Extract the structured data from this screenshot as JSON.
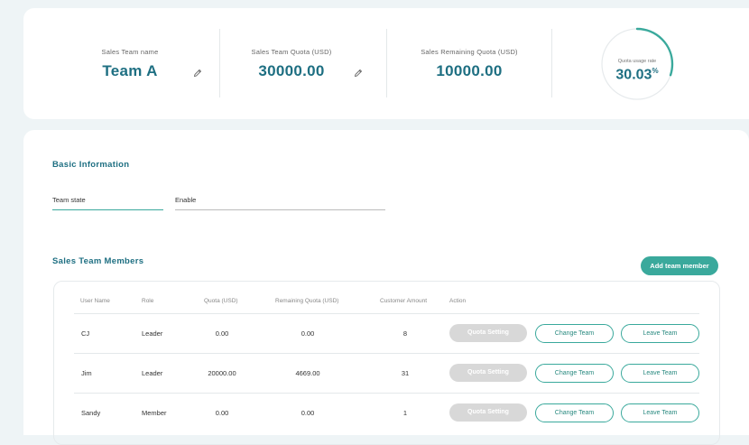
{
  "summary": {
    "team_name_label": "Sales Team name",
    "team_name": "Team A",
    "quota_label": "Sales Team Quota (USD)",
    "quota": "30000.00",
    "remaining_label": "Sales Remaining Quota (USD)",
    "remaining": "10000.00",
    "usage_label": "Quota usage rate",
    "usage_value": "30.03",
    "usage_unit": "%",
    "usage_fraction": 0.3003
  },
  "basic": {
    "title": "Basic Information",
    "state_label": "Team state",
    "state_value": "Enable"
  },
  "members": {
    "title": "Sales Team Members",
    "add_button": "Add team member",
    "columns": [
      "User Name",
      "Role",
      "Quota (USD)",
      "Remaining Quota (USD)",
      "Customer Amount",
      "Action"
    ],
    "rows": [
      {
        "name": "CJ",
        "role": "Leader",
        "quota": "0.00",
        "remaining": "0.00",
        "customers": "8"
      },
      {
        "name": "Jim",
        "role": "Leader",
        "quota": "20000.00",
        "remaining": "4669.00",
        "customers": "31"
      },
      {
        "name": "Sandy",
        "role": "Member",
        "quota": "0.00",
        "remaining": "0.00",
        "customers": "1"
      }
    ],
    "actions": {
      "quota_setting": "Quota Setting",
      "change_team": "Change Team",
      "leave_team": "Leave Team"
    }
  },
  "colors": {
    "accent": "#3aa99c",
    "title": "#1e6f82"
  }
}
